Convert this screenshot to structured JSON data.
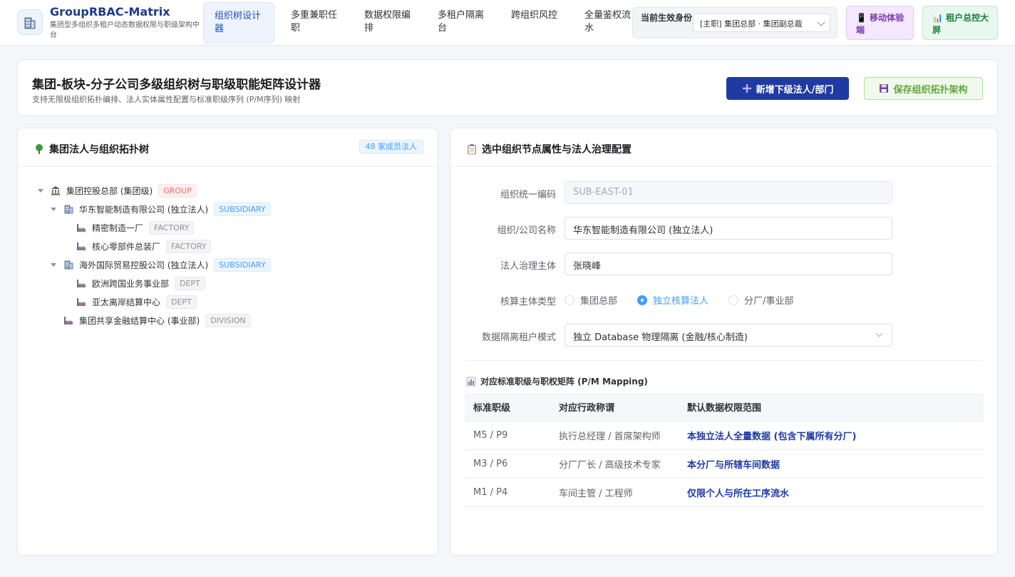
{
  "app": {
    "title": "GroupRBAC-Matrix",
    "subtitle": "集团型多组织多租户动态数据权限与职级架构中台"
  },
  "nav": {
    "items": [
      {
        "label": "组织树设计器",
        "active": true
      },
      {
        "label": "多重兼职任职",
        "active": false
      },
      {
        "label": "数据权限编排",
        "active": false
      },
      {
        "label": "多租户隔离台",
        "active": false
      },
      {
        "label": "跨组织风控",
        "active": false
      },
      {
        "label": "全量鉴权流水",
        "active": false
      }
    ]
  },
  "identity": {
    "label": "当前生效身份:",
    "value": "[主职] 集团总部 · 集团副总裁"
  },
  "header_buttons": {
    "mobile": "移动体验端",
    "screen": "租户总控大屏"
  },
  "page": {
    "title": "集团-板块-分子公司多级组织树与职级职能矩阵设计器",
    "subtitle": "支持无限极组织拓扑编排、法人实体属性配置与标准职级序列 (P/M序列) 映射",
    "add_button": "新增下级法人/部门",
    "save_button": "保存组织拓扑架构"
  },
  "tree_panel": {
    "title": "集团法人与组织拓扑树",
    "count": "48 家成员法人",
    "nodes": [
      {
        "label": "集团控股总部 (集团级)",
        "tag": "GROUP"
      },
      {
        "label": "华东智能制造有限公司 (独立法人)",
        "tag": "SUBSIDIARY"
      },
      {
        "label": "精密制造一厂",
        "tag": "FACTORY"
      },
      {
        "label": "核心零部件总装厂",
        "tag": "FACTORY"
      },
      {
        "label": "海外国际贸易控股公司 (独立法人)",
        "tag": "SUBSIDIARY"
      },
      {
        "label": "欧洲跨国业务事业部",
        "tag": "DEPT"
      },
      {
        "label": "亚太离岸结算中心",
        "tag": "DEPT"
      },
      {
        "label": "集团共享金融结算中心 (事业部)",
        "tag": "DIVISION"
      }
    ]
  },
  "detail_panel": {
    "title": "选中组织节点属性与法人治理配置",
    "form": {
      "code_label": "组织统一编码",
      "code_value": "SUB-EAST-01",
      "name_label": "组织/公司名称",
      "name_value": "华东智能制造有限公司 (独立法人)",
      "governance_label": "法人治理主体",
      "governance_value": "张晓峰",
      "type_label": "核算主体类型",
      "type_options": [
        "集团总部",
        "独立核算法人",
        "分厂/事业部"
      ],
      "type_selected": "独立核算法人",
      "tenant_label": "数据隔离租户模式",
      "tenant_value": "独立 Database 物理隔离 (金融/核心制造)"
    },
    "matrix": {
      "title": "对应标准职级与职权矩阵 (P/M Mapping)",
      "headers": [
        "标准职级",
        "对应行政称谓",
        "默认数据权限范围"
      ],
      "rows": [
        {
          "grade": "M5 / P9",
          "title": "执行总经理 / 首席架构师",
          "scope": "本独立法人全量数据 (包含下属所有分厂)"
        },
        {
          "grade": "M3 / P6",
          "title": "分厂厂长 / 高级技术专家",
          "scope": "本分厂与所辖车间数据"
        },
        {
          "grade": "M1 / P4",
          "title": "车间主管 / 工程师",
          "scope": "仅限个人与所在工序流水"
        }
      ]
    }
  }
}
